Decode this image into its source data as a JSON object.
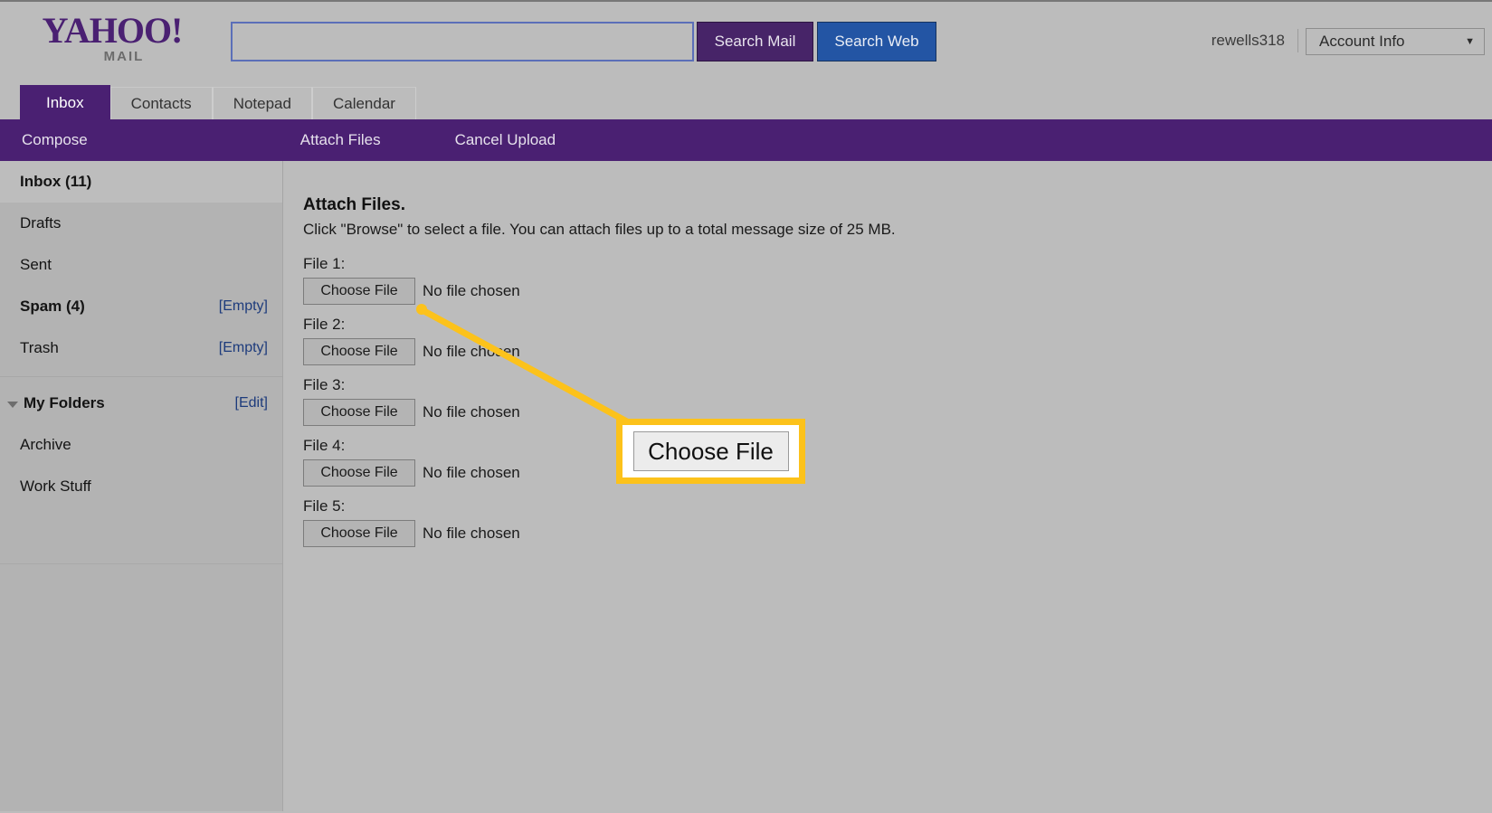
{
  "colors": {
    "page_bg": "#bcbcbc",
    "brand_purple": "#4a2072",
    "search_web_blue": "#2355a4",
    "link_blue": "#1d3b7c",
    "annotation_yellow": "#fcc21b"
  },
  "header": {
    "logo_main": "YAHOO!",
    "logo_sub": "MAIL",
    "search": {
      "value": "",
      "placeholder": ""
    },
    "search_mail_label": "Search Mail",
    "search_web_label": "Search Web",
    "account_name": "rewells318",
    "account_info_label": "Account Info",
    "account_info_caret": "▼"
  },
  "tabs": [
    {
      "label": "Inbox",
      "active": true
    },
    {
      "label": "Contacts",
      "active": false
    },
    {
      "label": "Notepad",
      "active": false
    },
    {
      "label": "Calendar",
      "active": false
    }
  ],
  "toolbar": {
    "compose_label": "Compose",
    "attach_files_label": "Attach Files",
    "cancel_upload_label": "Cancel Upload"
  },
  "sidebar": {
    "folders": [
      {
        "label": "Inbox (11)",
        "action": "",
        "bold": true,
        "selected": true
      },
      {
        "label": "Drafts",
        "action": "",
        "bold": false,
        "selected": false
      },
      {
        "label": "Sent",
        "action": "",
        "bold": false,
        "selected": false
      },
      {
        "label": "Spam (4)",
        "action": "[Empty]",
        "bold": true,
        "selected": false
      },
      {
        "label": "Trash",
        "action": "[Empty]",
        "bold": false,
        "selected": false
      }
    ],
    "my_folders_label": "My Folders",
    "my_folders_action": "[Edit]",
    "custom_folders": [
      {
        "label": "Archive"
      },
      {
        "label": "Work Stuff"
      }
    ]
  },
  "main": {
    "title": "Attach Files.",
    "description": "Click \"Browse\" to select a file. You can attach files up to a total message size of 25 MB.",
    "choose_file_label": "Choose File",
    "no_file_text": "No file chosen",
    "file_rows": [
      {
        "label": "File 1:"
      },
      {
        "label": "File 2:"
      },
      {
        "label": "File 3:"
      },
      {
        "label": "File 4:"
      },
      {
        "label": "File 5:"
      }
    ]
  },
  "annotation": {
    "callout_label": "Choose File"
  }
}
